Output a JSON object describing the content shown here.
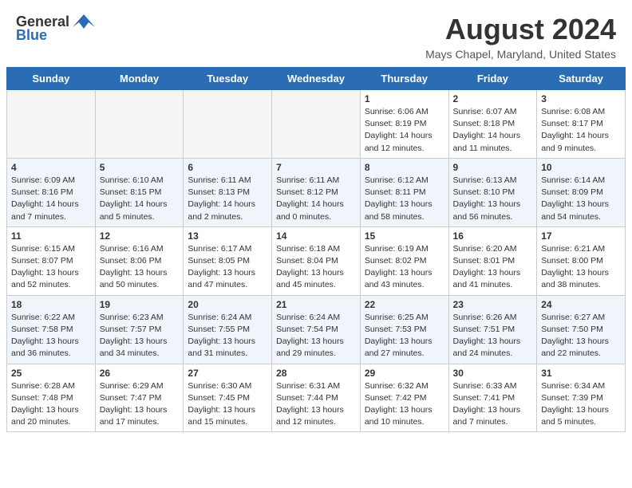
{
  "header": {
    "logo_general": "General",
    "logo_blue": "Blue",
    "month_year": "August 2024",
    "location": "Mays Chapel, Maryland, United States"
  },
  "days_of_week": [
    "Sunday",
    "Monday",
    "Tuesday",
    "Wednesday",
    "Thursday",
    "Friday",
    "Saturday"
  ],
  "weeks": [
    [
      {
        "day": "",
        "info": ""
      },
      {
        "day": "",
        "info": ""
      },
      {
        "day": "",
        "info": ""
      },
      {
        "day": "",
        "info": ""
      },
      {
        "day": "1",
        "info": "Sunrise: 6:06 AM\nSunset: 8:19 PM\nDaylight: 14 hours\nand 12 minutes."
      },
      {
        "day": "2",
        "info": "Sunrise: 6:07 AM\nSunset: 8:18 PM\nDaylight: 14 hours\nand 11 minutes."
      },
      {
        "day": "3",
        "info": "Sunrise: 6:08 AM\nSunset: 8:17 PM\nDaylight: 14 hours\nand 9 minutes."
      }
    ],
    [
      {
        "day": "4",
        "info": "Sunrise: 6:09 AM\nSunset: 8:16 PM\nDaylight: 14 hours\nand 7 minutes."
      },
      {
        "day": "5",
        "info": "Sunrise: 6:10 AM\nSunset: 8:15 PM\nDaylight: 14 hours\nand 5 minutes."
      },
      {
        "day": "6",
        "info": "Sunrise: 6:11 AM\nSunset: 8:13 PM\nDaylight: 14 hours\nand 2 minutes."
      },
      {
        "day": "7",
        "info": "Sunrise: 6:11 AM\nSunset: 8:12 PM\nDaylight: 14 hours\nand 0 minutes."
      },
      {
        "day": "8",
        "info": "Sunrise: 6:12 AM\nSunset: 8:11 PM\nDaylight: 13 hours\nand 58 minutes."
      },
      {
        "day": "9",
        "info": "Sunrise: 6:13 AM\nSunset: 8:10 PM\nDaylight: 13 hours\nand 56 minutes."
      },
      {
        "day": "10",
        "info": "Sunrise: 6:14 AM\nSunset: 8:09 PM\nDaylight: 13 hours\nand 54 minutes."
      }
    ],
    [
      {
        "day": "11",
        "info": "Sunrise: 6:15 AM\nSunset: 8:07 PM\nDaylight: 13 hours\nand 52 minutes."
      },
      {
        "day": "12",
        "info": "Sunrise: 6:16 AM\nSunset: 8:06 PM\nDaylight: 13 hours\nand 50 minutes."
      },
      {
        "day": "13",
        "info": "Sunrise: 6:17 AM\nSunset: 8:05 PM\nDaylight: 13 hours\nand 47 minutes."
      },
      {
        "day": "14",
        "info": "Sunrise: 6:18 AM\nSunset: 8:04 PM\nDaylight: 13 hours\nand 45 minutes."
      },
      {
        "day": "15",
        "info": "Sunrise: 6:19 AM\nSunset: 8:02 PM\nDaylight: 13 hours\nand 43 minutes."
      },
      {
        "day": "16",
        "info": "Sunrise: 6:20 AM\nSunset: 8:01 PM\nDaylight: 13 hours\nand 41 minutes."
      },
      {
        "day": "17",
        "info": "Sunrise: 6:21 AM\nSunset: 8:00 PM\nDaylight: 13 hours\nand 38 minutes."
      }
    ],
    [
      {
        "day": "18",
        "info": "Sunrise: 6:22 AM\nSunset: 7:58 PM\nDaylight: 13 hours\nand 36 minutes."
      },
      {
        "day": "19",
        "info": "Sunrise: 6:23 AM\nSunset: 7:57 PM\nDaylight: 13 hours\nand 34 minutes."
      },
      {
        "day": "20",
        "info": "Sunrise: 6:24 AM\nSunset: 7:55 PM\nDaylight: 13 hours\nand 31 minutes."
      },
      {
        "day": "21",
        "info": "Sunrise: 6:24 AM\nSunset: 7:54 PM\nDaylight: 13 hours\nand 29 minutes."
      },
      {
        "day": "22",
        "info": "Sunrise: 6:25 AM\nSunset: 7:53 PM\nDaylight: 13 hours\nand 27 minutes."
      },
      {
        "day": "23",
        "info": "Sunrise: 6:26 AM\nSunset: 7:51 PM\nDaylight: 13 hours\nand 24 minutes."
      },
      {
        "day": "24",
        "info": "Sunrise: 6:27 AM\nSunset: 7:50 PM\nDaylight: 13 hours\nand 22 minutes."
      }
    ],
    [
      {
        "day": "25",
        "info": "Sunrise: 6:28 AM\nSunset: 7:48 PM\nDaylight: 13 hours\nand 20 minutes."
      },
      {
        "day": "26",
        "info": "Sunrise: 6:29 AM\nSunset: 7:47 PM\nDaylight: 13 hours\nand 17 minutes."
      },
      {
        "day": "27",
        "info": "Sunrise: 6:30 AM\nSunset: 7:45 PM\nDaylight: 13 hours\nand 15 minutes."
      },
      {
        "day": "28",
        "info": "Sunrise: 6:31 AM\nSunset: 7:44 PM\nDaylight: 13 hours\nand 12 minutes."
      },
      {
        "day": "29",
        "info": "Sunrise: 6:32 AM\nSunset: 7:42 PM\nDaylight: 13 hours\nand 10 minutes."
      },
      {
        "day": "30",
        "info": "Sunrise: 6:33 AM\nSunset: 7:41 PM\nDaylight: 13 hours\nand 7 minutes."
      },
      {
        "day": "31",
        "info": "Sunrise: 6:34 AM\nSunset: 7:39 PM\nDaylight: 13 hours\nand 5 minutes."
      }
    ]
  ]
}
